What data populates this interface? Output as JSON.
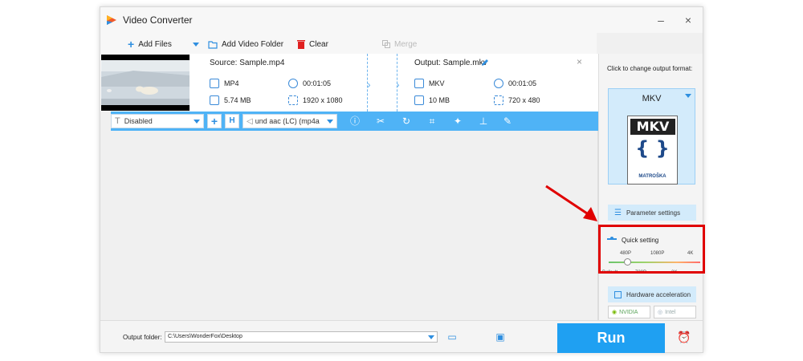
{
  "app": {
    "title": "Video Converter",
    "minimize": "–",
    "close": "×"
  },
  "toolbar": {
    "add_files": "Add Files",
    "add_video_folder": "Add Video Folder",
    "clear": "Clear",
    "merge": "Merge"
  },
  "file": {
    "source_label": "Source: Sample.mp4",
    "output_label": "Output: Sample.mkv",
    "source_format": "MP4",
    "source_duration": "00:01:05",
    "source_size": "5.74 MB",
    "source_resolution": "1920 x 1080",
    "output_format": "MKV",
    "output_duration": "00:01:05",
    "output_size": "10 MB",
    "output_resolution": "720 x 480"
  },
  "file_toolbar": {
    "subtitle_value": "Disabled",
    "audio_value": "und aac (LC) (mp4a"
  },
  "right_panel": {
    "header": "Click to change output format:",
    "format_name": "MKV",
    "logo_text": "MKV",
    "logo_brace": "{ }",
    "logo_sub": "MATROŠKA",
    "parameter_settings": "Parameter settings",
    "quick_setting": "Quick setting",
    "ticks_top": [
      "480P",
      "1080P",
      "4K"
    ],
    "ticks_bottom": [
      "Default",
      "720P",
      "2K"
    ],
    "quality_level": 0.2,
    "hardware_acceleration": "Hardware acceleration",
    "nvidia": "NVIDIA",
    "intel": "Intel"
  },
  "bottom": {
    "output_folder_label": "Output folder:",
    "output_folder_path": "C:\\Users\\WonderFox\\Desktop",
    "run": "Run"
  },
  "colors": {
    "accent": "#1fa0f2",
    "toolbar_blue": "#4fb3f6",
    "highlight_red": "#e00000"
  }
}
